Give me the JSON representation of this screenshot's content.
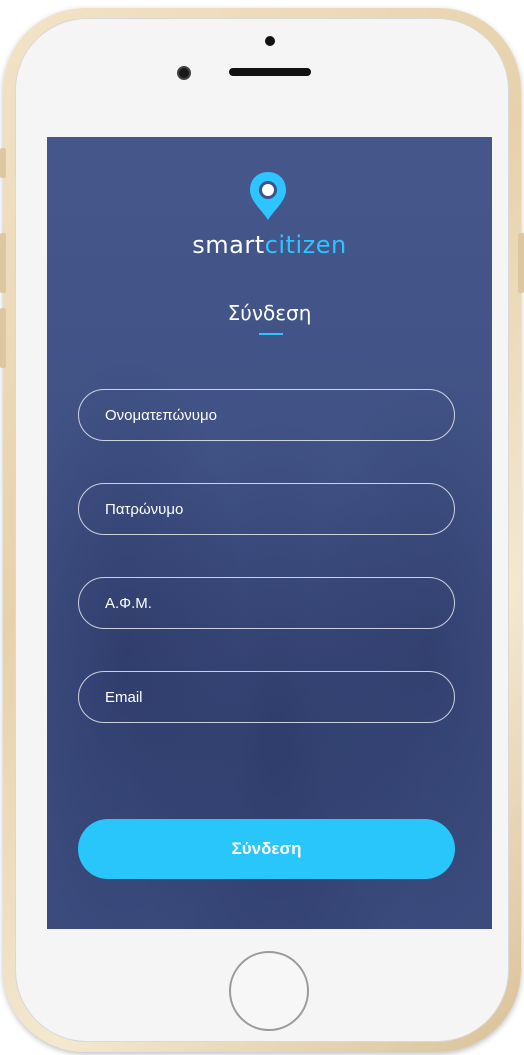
{
  "brand": {
    "part1": "smart",
    "part2": "citizen",
    "accent_color": "#2ec4ff"
  },
  "screen": {
    "title": "Σύνδεση",
    "background_color": "#3f5187"
  },
  "form": {
    "fields": [
      {
        "placeholder": "Ονοματεπώνυμο",
        "value": ""
      },
      {
        "placeholder": "Πατρώνυμο",
        "value": ""
      },
      {
        "placeholder": "Α.Φ.Μ.",
        "value": ""
      },
      {
        "placeholder": "Email",
        "value": ""
      }
    ],
    "submit_label": "Σύνδεση",
    "submit_color": "#28c6fb"
  },
  "icons": {
    "logo": "location-pin-icon"
  }
}
